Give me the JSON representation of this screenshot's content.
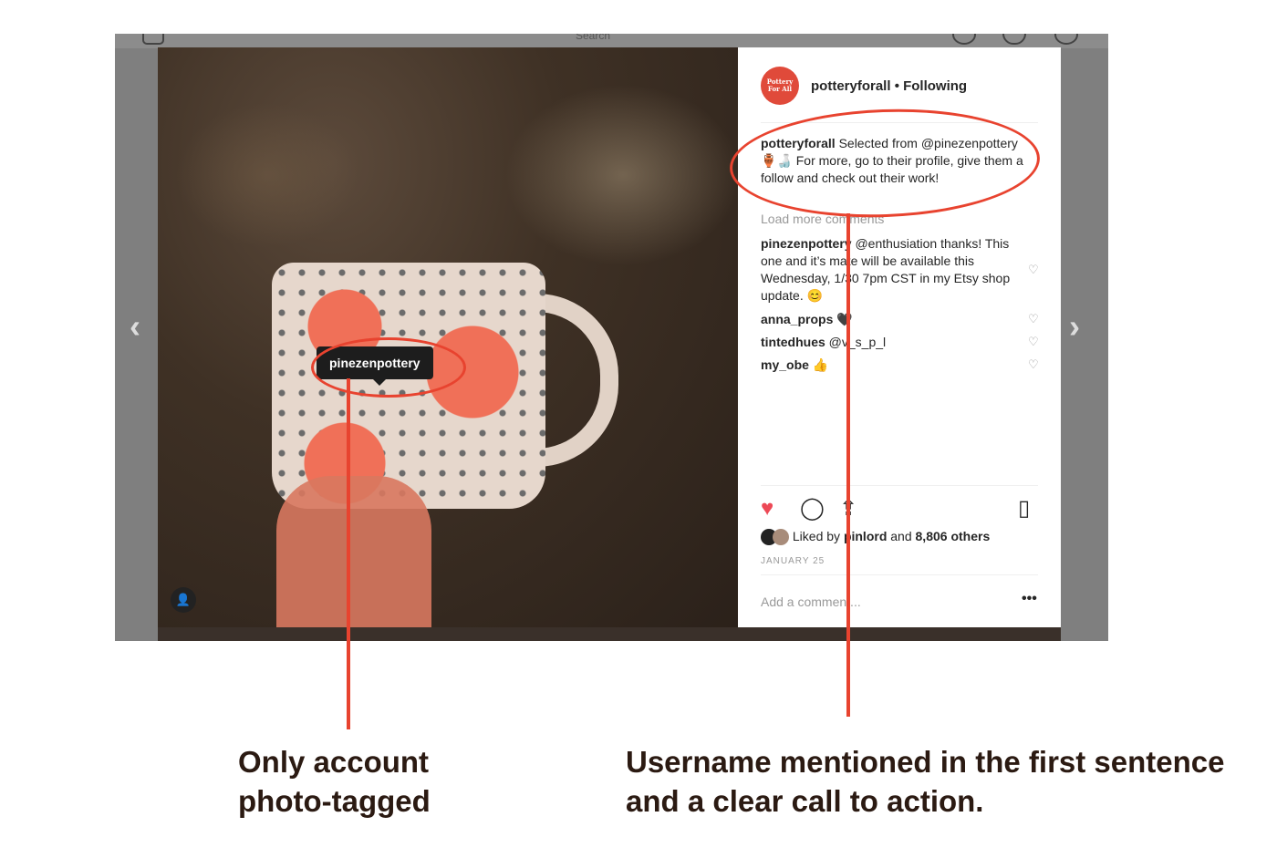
{
  "topbar": {
    "search_placeholder": "Search",
    "logo_icon": "instagram-icon",
    "right_icons": [
      "explore-icon",
      "heart-icon",
      "profile-icon"
    ]
  },
  "photo": {
    "tag_username": "pinezenpottery",
    "prev_arrow": "‹",
    "next_arrow": "›"
  },
  "post": {
    "avatar_text": "Pottery For All",
    "username": "potteryforall",
    "follow_status": "• Following",
    "caption_user": "potteryforall",
    "caption_text": " Selected from @pinezenpottery 🏺🍶 For more, go to their profile, give them a follow and check out their work!",
    "load_more": "Load more comments",
    "comments": [
      {
        "user": "pinezenpottery",
        "text": " @enthusiation thanks! This one and it’s mate will be available this Wednesday, 1/30 7pm CST in my Etsy shop update. 😊"
      },
      {
        "user": "anna_props",
        "text": " 🖤"
      },
      {
        "user": "tintedhues",
        "text": " @v_s_p_l"
      },
      {
        "user": "my_obe",
        "text": " 👍"
      }
    ],
    "likes_prefix": "Liked by ",
    "likes_user": "pinlord",
    "likes_suffix": " and ",
    "likes_count": "8,806 others",
    "date": "JANUARY 25",
    "add_comment_placeholder": "Add a comment...",
    "more_label": "•••"
  },
  "annotations": {
    "left": "Only account photo-tagged",
    "right": "Username mentioned in the first sentence and a clear call to action."
  },
  "colors": {
    "annotation_red": "#e8432f",
    "annotation_text": "#2b1a12",
    "like_red": "#ed4956"
  }
}
